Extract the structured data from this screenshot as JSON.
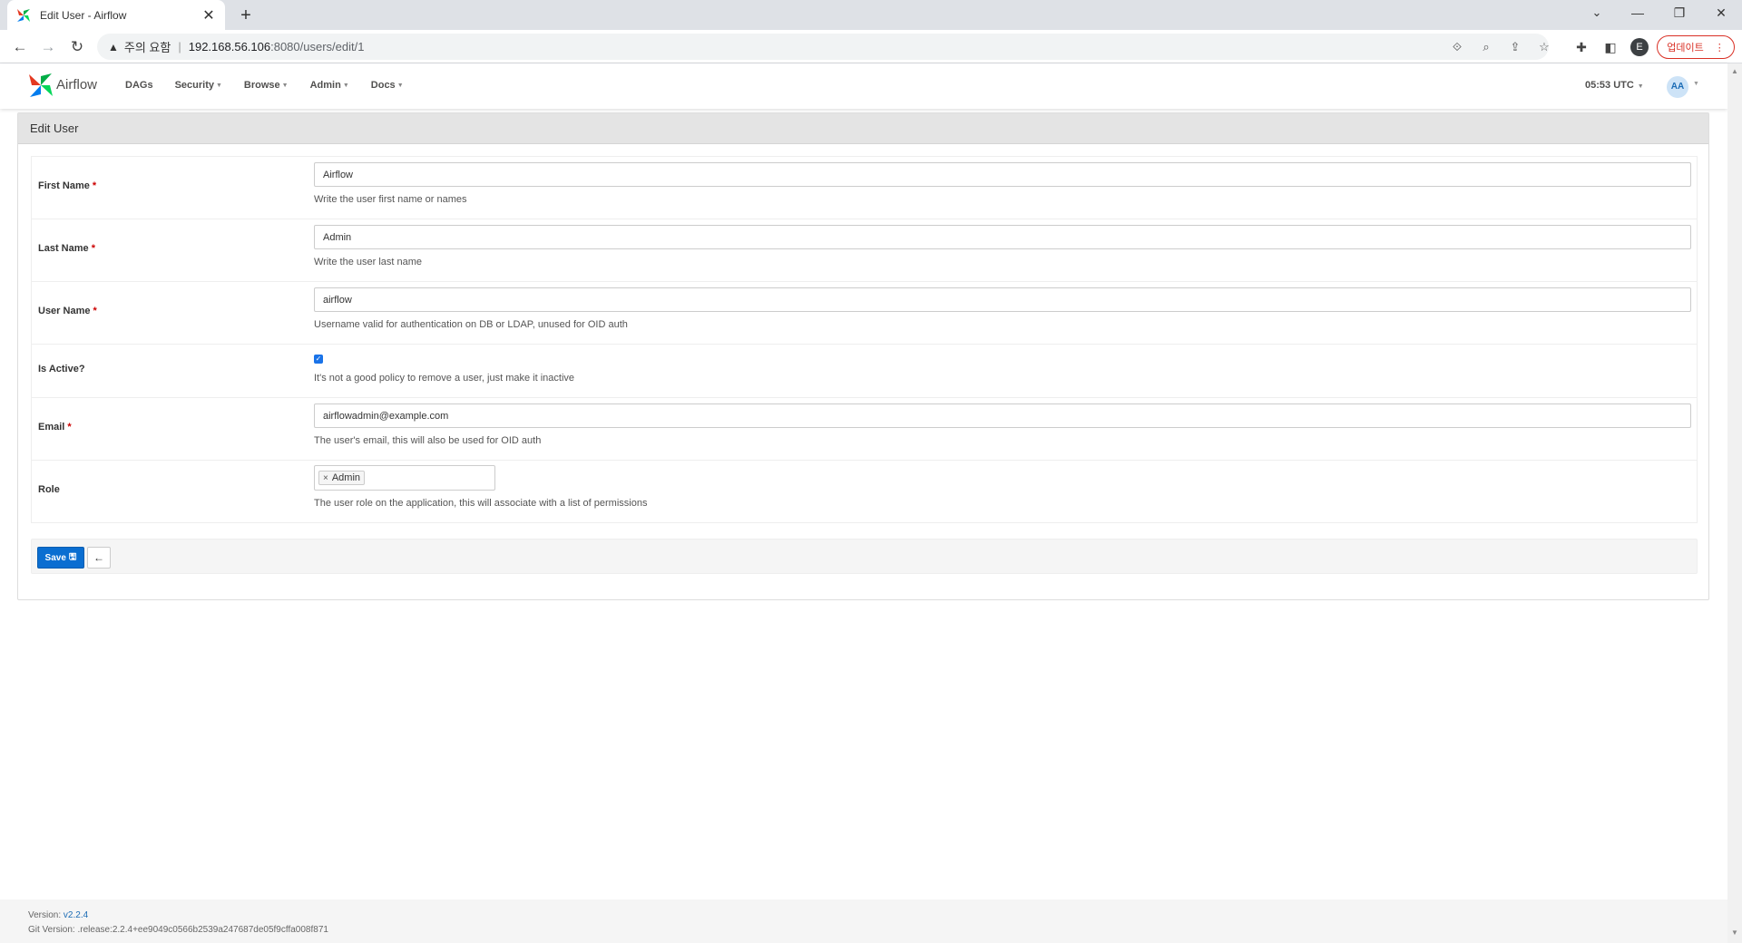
{
  "browser": {
    "tab_title": "Edit User - Airflow",
    "tab_close": "✕",
    "new_tab": "+",
    "url_warning": "주의 요함",
    "url_host": "192.168.56.106",
    "url_path": ":8080/users/edit/1",
    "profile_initial": "E",
    "update_label": "업데이트"
  },
  "navbar": {
    "brand": "Airflow",
    "menu": [
      "DAGs",
      "Security",
      "Browse",
      "Admin",
      "Docs"
    ],
    "time": "05:53 UTC",
    "avatar": "AA"
  },
  "panel": {
    "title": "Edit User"
  },
  "form": {
    "first_name": {
      "label": "First Name",
      "required": "*",
      "value": "Airflow",
      "help": "Write the user first name or names"
    },
    "last_name": {
      "label": "Last Name",
      "required": "*",
      "value": "Admin",
      "help": "Write the user last name"
    },
    "user_name": {
      "label": "User Name",
      "required": "*",
      "value": "airflow",
      "help": "Username valid for authentication on DB or LDAP, unused for OID auth"
    },
    "is_active": {
      "label": "Is Active?",
      "checked": true,
      "help": "It's not a good policy to remove a user, just make it inactive"
    },
    "email": {
      "label": "Email",
      "required": "*",
      "value": "airflowadmin@example.com",
      "help": "The user's email, this will also be used for OID auth"
    },
    "role": {
      "label": "Role",
      "tag": "Admin",
      "tag_remove": "×",
      "help": "The user role on the application, this will associate with a list of permissions"
    }
  },
  "actions": {
    "save_label": "Save",
    "back_icon": "arrow-left-icon"
  },
  "footer": {
    "version_label": "Version:",
    "version_value": "v2.2.4",
    "git_label": "Git Version:",
    "git_value": ".release:2.2.4+ee9049c0566b2539a247687de05f9cffa008f871"
  }
}
